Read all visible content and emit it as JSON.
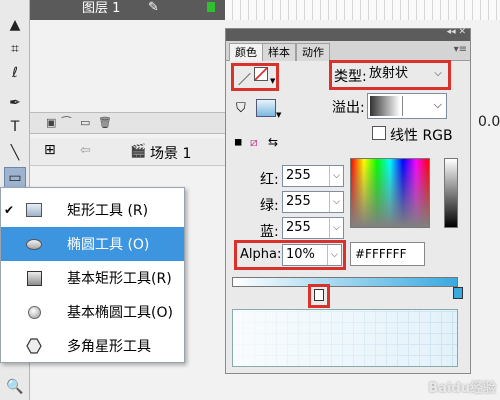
{
  "timeline": {
    "layer_name": "图层 1"
  },
  "stage": {
    "scene_name": "场景 1",
    "coord_value": "0.0"
  },
  "tool_menu": {
    "items": [
      {
        "label": "矩形工具 (R)",
        "checked": true,
        "highlighted": false,
        "icon": "rectangle-icon"
      },
      {
        "label": "椭圆工具 (O)",
        "checked": false,
        "highlighted": true,
        "icon": "oval-icon"
      },
      {
        "label": "基本矩形工具(R)",
        "checked": false,
        "highlighted": false,
        "icon": "primitive-rectangle-icon"
      },
      {
        "label": "基本椭圆工具(O)",
        "checked": false,
        "highlighted": false,
        "icon": "primitive-oval-icon"
      },
      {
        "label": "多角星形工具",
        "checked": false,
        "highlighted": false,
        "icon": "polystar-icon"
      }
    ],
    "check_mark": "✔"
  },
  "color_panel": {
    "tabs": [
      "颜色",
      "样本",
      "动作"
    ],
    "active_tab": "颜色",
    "type_label": "类型:",
    "type_value": "放射状",
    "overflow_label": "溢出:",
    "linear_rgb_label": "线性 RGB",
    "red_label": "红:",
    "red_value": "255",
    "green_label": "绿:",
    "green_value": "255",
    "blue_label": "蓝:",
    "blue_value": "255",
    "alpha_label": "Alpha:",
    "alpha_value": "10%",
    "hex_value": "#FFFFFF",
    "gradient_end_color": "#39a9e0"
  },
  "watermark": "Baidu经验"
}
